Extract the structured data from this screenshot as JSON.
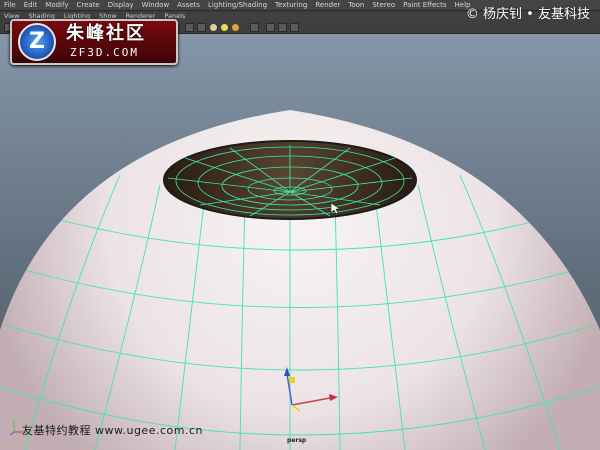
{
  "menubar": {
    "items": [
      "File",
      "Edit",
      "Modify",
      "Create",
      "Display",
      "Window",
      "Assets",
      "Lighting/Shading",
      "Texturing",
      "Render",
      "Toon",
      "Stereo",
      "Paint Effects",
      "Help"
    ]
  },
  "panel_menu": {
    "items": [
      "View",
      "Shading",
      "Lighting",
      "Show",
      "Renderer",
      "Panels"
    ]
  },
  "watermark": {
    "copyright": "© 杨庆钊 • 友基科技",
    "logo_cn": "朱峰社区",
    "logo_en": "ZF3D.COM",
    "logo_letter": "Z",
    "footer": "友基特约教程 www.ugee.com.cn"
  },
  "viewport": {
    "camera": "persp"
  },
  "colors": {
    "wireframe": "#3fe6a8",
    "sphere_light": "#f3eef0",
    "sphere_shadow": "#c9b8bc",
    "opening_interior": "#3a2a1a",
    "logo_red": "#7a0a0e"
  }
}
